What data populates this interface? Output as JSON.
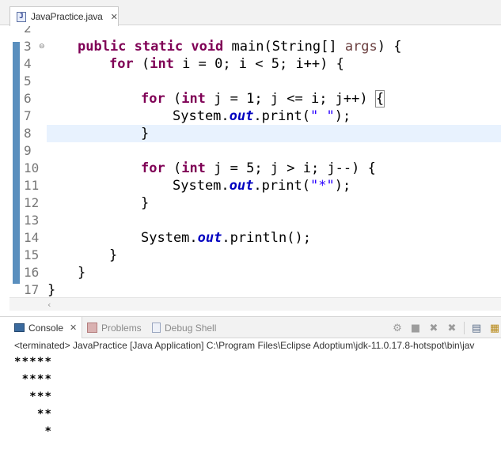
{
  "editor": {
    "tab_label": "JavaPractice.java",
    "tab_icon": "java-file-icon",
    "line_numbers": [
      "2",
      "3",
      "4",
      "5",
      "6",
      "7",
      "8",
      "9",
      "10",
      "11",
      "12",
      "13",
      "14",
      "15",
      "16",
      "17"
    ],
    "folded_line": "3",
    "current_line": "8",
    "code": {
      "l3": {
        "k1": "public",
        "k2": "static",
        "k3": "void",
        "t1": " main(String[] ",
        "p1": "args",
        "t2": ") {"
      },
      "l4": {
        "k1": "for",
        "t1": " (",
        "k2": "int",
        "t2": " i = 0; i < 5; i++) {"
      },
      "l6": {
        "k1": "for",
        "t1": " (",
        "k2": "int",
        "t2": " j = 1; j <= i; j++) ",
        "b1": "{"
      },
      "l7": {
        "t1": "System.",
        "f1": "out",
        "t2": ".print(",
        "s1": "\" \"",
        "t3": ");"
      },
      "l8": {
        "t1": "}"
      },
      "l10": {
        "k1": "for",
        "t1": " (",
        "k2": "int",
        "t2": " j = 5; j > i; j--) {"
      },
      "l11": {
        "t1": "System.",
        "f1": "out",
        "t2": ".print(",
        "s1": "\"*\"",
        "t3": ");"
      },
      "l12": {
        "t1": "}"
      },
      "l14": {
        "t1": "System.",
        "f1": "out",
        "t2": ".println();"
      },
      "l15": {
        "t1": "}"
      },
      "l16": {
        "t1": "}"
      },
      "l17": {
        "t1": "}"
      }
    }
  },
  "console": {
    "tabs": [
      {
        "label": "Console",
        "icon": "console-icon",
        "active": true
      },
      {
        "label": "Problems",
        "icon": "problems-icon",
        "active": false
      },
      {
        "label": "Debug Shell",
        "icon": "debug-shell-icon",
        "active": false
      }
    ],
    "toolbar_icons": [
      "remove-launch-icon",
      "terminate-icon",
      "remove-icon",
      "remove-all-icon",
      "pin-console-icon",
      "open-console-icon"
    ],
    "status": "<terminated> JavaPractice [Java Application] C:\\Program Files\\Eclipse Adoptium\\jdk-11.0.17.8-hotspot\\bin\\jav",
    "output": [
      "*****",
      " ****",
      "  ***",
      "   **",
      "    *"
    ]
  },
  "colors": {
    "keyword": "#7f0055",
    "string": "#2a00ff",
    "static_field": "#0000c0",
    "parameter": "#6a3e3e",
    "scope_bar": "#5a8fbe",
    "current_line": "#e8f2fe"
  }
}
